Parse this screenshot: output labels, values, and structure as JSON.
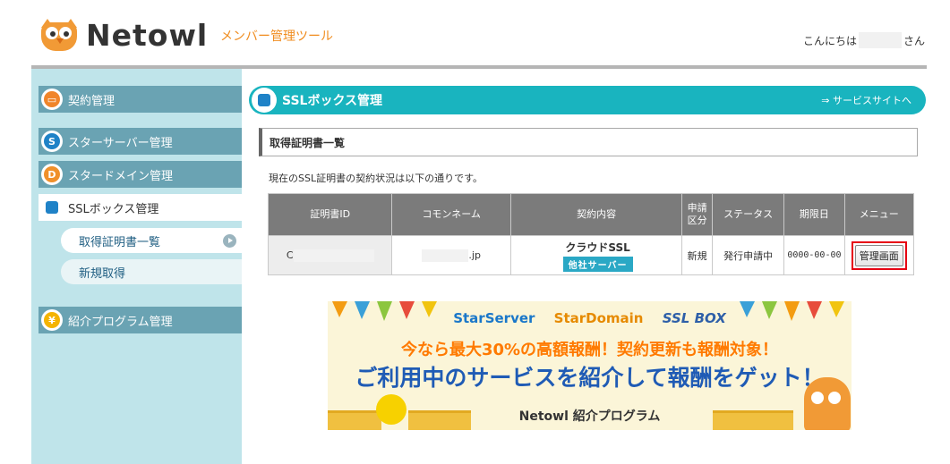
{
  "header": {
    "logo_text": "Netowl",
    "tool_name": "メンバー管理ツール",
    "greeting_prefix": "こんにちは",
    "greeting_suffix": "さん"
  },
  "sidebar": {
    "items": [
      {
        "label": "契約管理",
        "icon": "contract-icon",
        "color": "#f0852a"
      },
      {
        "label": "スターサーバー管理",
        "icon": "starserver-icon",
        "color": "#1f82c7"
      },
      {
        "label": "スタードメイン管理",
        "icon": "stardomain-icon",
        "color": "#f0902a"
      },
      {
        "label": "SSLボックス管理",
        "icon": "sslbox-icon",
        "color": "#1f82c7"
      },
      {
        "label": "紹介プログラム管理",
        "icon": "referral-yen-icon",
        "color": "#f4b400"
      }
    ],
    "sub_items": [
      {
        "label": "取得証明書一覧"
      },
      {
        "label": "新規取得"
      }
    ]
  },
  "main": {
    "section_bar_title": "SSLボックス管理",
    "service_link": "⇒ サービスサイトへ",
    "page_title": "取得証明書一覧",
    "description": "現在のSSL証明書の契約状況は以下の通りです。",
    "table": {
      "headers": [
        "証明書ID",
        "コモンネーム",
        "契約内容",
        "申請\n区分",
        "ステータス",
        "期限日",
        "メニュー"
      ],
      "rows": [
        {
          "cert_id_prefix": "C",
          "common_name_suffix": ".jp",
          "contract_name": "クラウドSSL",
          "contract_badge": "他社サーバー",
          "application_type": "新規",
          "status": "発行申請中",
          "expiry": "0000-00-00",
          "menu_button": "管理画面"
        }
      ]
    }
  },
  "banner": {
    "brand1": "StarServer",
    "brand2": "StarDomain",
    "brand3": "SSL BOX",
    "line1": "今なら最大30%の高額報酬！契約更新も報酬対象！",
    "line2": "ご利用中のサービスを紹介して報酬をゲット！",
    "footer": "Netowl 紹介プログラム"
  },
  "colors": {
    "accent_teal": "#19b4bf",
    "sidebar_bg": "#bfe4ea",
    "nav_dark": "#6aa3b3",
    "orange": "#f08c1e",
    "highlight_red": "#e60012"
  }
}
